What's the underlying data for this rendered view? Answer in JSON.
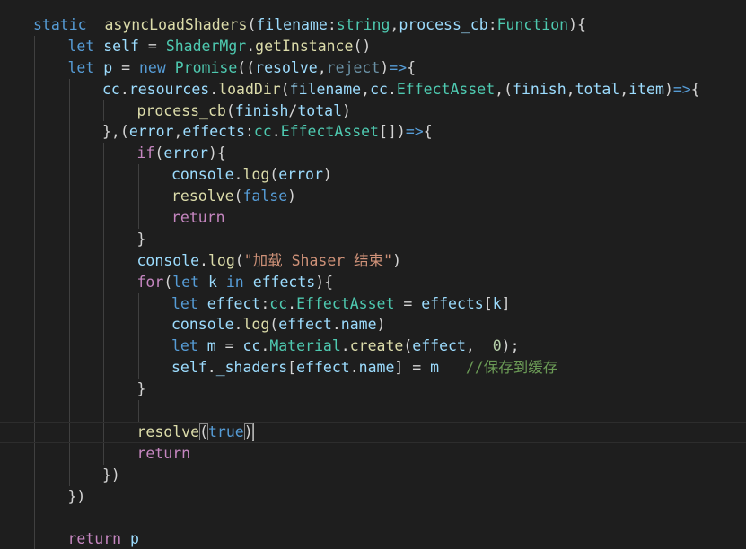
{
  "editor": {
    "colors": {
      "background": "#1e1e1e",
      "keyword": "#569cd6",
      "control": "#c586c0",
      "function": "#dcdcaa",
      "variable": "#9cdcfe",
      "type": "#4ec9b0",
      "string": "#ce9178",
      "number": "#b5cea8",
      "comment": "#6a9955"
    },
    "current_line": 19,
    "lines": [
      {
        "indent": 0,
        "tokens": [
          {
            "t": "static",
            "c": "kw"
          },
          {
            "t": "  "
          },
          {
            "t": "asyncLoadShaders",
            "c": "fn"
          },
          {
            "t": "("
          },
          {
            "t": "filename",
            "c": "var"
          },
          {
            "t": ":"
          },
          {
            "t": "string",
            "c": "type"
          },
          {
            "t": ","
          },
          {
            "t": "process_cb",
            "c": "var"
          },
          {
            "t": ":"
          },
          {
            "t": "Function",
            "c": "type"
          },
          {
            "t": "){"
          }
        ]
      },
      {
        "indent": 1,
        "tokens": [
          {
            "t": "let",
            "c": "kw"
          },
          {
            "t": " "
          },
          {
            "t": "self",
            "c": "var"
          },
          {
            "t": " = "
          },
          {
            "t": "ShaderMgr",
            "c": "type"
          },
          {
            "t": "."
          },
          {
            "t": "getInstance",
            "c": "fn"
          },
          {
            "t": "()"
          }
        ]
      },
      {
        "indent": 1,
        "tokens": [
          {
            "t": "let",
            "c": "kw"
          },
          {
            "t": " "
          },
          {
            "t": "p",
            "c": "var"
          },
          {
            "t": " = "
          },
          {
            "t": "new",
            "c": "kw"
          },
          {
            "t": " "
          },
          {
            "t": "Promise",
            "c": "type"
          },
          {
            "t": "(("
          },
          {
            "t": "resolve",
            "c": "var"
          },
          {
            "t": ","
          },
          {
            "t": "reject",
            "c": "unused"
          },
          {
            "t": ")"
          },
          {
            "t": "=>",
            "c": "kw"
          },
          {
            "t": "{"
          }
        ]
      },
      {
        "indent": 2,
        "tokens": [
          {
            "t": "cc",
            "c": "var"
          },
          {
            "t": "."
          },
          {
            "t": "resources",
            "c": "var"
          },
          {
            "t": "."
          },
          {
            "t": "loadDir",
            "c": "fn"
          },
          {
            "t": "("
          },
          {
            "t": "filename",
            "c": "var"
          },
          {
            "t": ","
          },
          {
            "t": "cc",
            "c": "var"
          },
          {
            "t": "."
          },
          {
            "t": "EffectAsset",
            "c": "type"
          },
          {
            "t": ",("
          },
          {
            "t": "finish",
            "c": "var"
          },
          {
            "t": ","
          },
          {
            "t": "total",
            "c": "var"
          },
          {
            "t": ","
          },
          {
            "t": "item",
            "c": "var"
          },
          {
            "t": ")"
          },
          {
            "t": "=>",
            "c": "kw"
          },
          {
            "t": "{"
          }
        ]
      },
      {
        "indent": 3,
        "tokens": [
          {
            "t": "process_cb",
            "c": "fn"
          },
          {
            "t": "("
          },
          {
            "t": "finish",
            "c": "var"
          },
          {
            "t": "/"
          },
          {
            "t": "total",
            "c": "var"
          },
          {
            "t": ")"
          }
        ]
      },
      {
        "indent": 2,
        "tokens": [
          {
            "t": "},("
          },
          {
            "t": "error",
            "c": "var"
          },
          {
            "t": ","
          },
          {
            "t": "effects",
            "c": "var"
          },
          {
            "t": ":"
          },
          {
            "t": "cc",
            "c": "type"
          },
          {
            "t": "."
          },
          {
            "t": "EffectAsset",
            "c": "type"
          },
          {
            "t": "[])"
          },
          {
            "t": "=>",
            "c": "kw"
          },
          {
            "t": "{"
          }
        ]
      },
      {
        "indent": 3,
        "tokens": [
          {
            "t": "if",
            "c": "ctrl"
          },
          {
            "t": "("
          },
          {
            "t": "error",
            "c": "var"
          },
          {
            "t": "){"
          }
        ]
      },
      {
        "indent": 4,
        "tokens": [
          {
            "t": "console",
            "c": "var"
          },
          {
            "t": "."
          },
          {
            "t": "log",
            "c": "fn"
          },
          {
            "t": "("
          },
          {
            "t": "error",
            "c": "var"
          },
          {
            "t": ")"
          }
        ]
      },
      {
        "indent": 4,
        "tokens": [
          {
            "t": "resolve",
            "c": "fn"
          },
          {
            "t": "("
          },
          {
            "t": "false",
            "c": "kw"
          },
          {
            "t": ")"
          }
        ]
      },
      {
        "indent": 4,
        "tokens": [
          {
            "t": "return",
            "c": "ctrl"
          }
        ]
      },
      {
        "indent": 3,
        "tokens": [
          {
            "t": "}"
          }
        ]
      },
      {
        "indent": 3,
        "tokens": [
          {
            "t": "console",
            "c": "var"
          },
          {
            "t": "."
          },
          {
            "t": "log",
            "c": "fn"
          },
          {
            "t": "("
          },
          {
            "t": "\"加载 Shaser 结束\"",
            "c": "str"
          },
          {
            "t": ")"
          }
        ]
      },
      {
        "indent": 3,
        "tokens": [
          {
            "t": "for",
            "c": "ctrl"
          },
          {
            "t": "("
          },
          {
            "t": "let",
            "c": "kw"
          },
          {
            "t": " "
          },
          {
            "t": "k",
            "c": "var"
          },
          {
            "t": " "
          },
          {
            "t": "in",
            "c": "kw"
          },
          {
            "t": " "
          },
          {
            "t": "effects",
            "c": "var"
          },
          {
            "t": "){"
          }
        ]
      },
      {
        "indent": 4,
        "tokens": [
          {
            "t": "let",
            "c": "kw"
          },
          {
            "t": " "
          },
          {
            "t": "effect",
            "c": "var"
          },
          {
            "t": ":"
          },
          {
            "t": "cc",
            "c": "type"
          },
          {
            "t": "."
          },
          {
            "t": "EffectAsset",
            "c": "type"
          },
          {
            "t": " = "
          },
          {
            "t": "effects",
            "c": "var"
          },
          {
            "t": "["
          },
          {
            "t": "k",
            "c": "var"
          },
          {
            "t": "]"
          }
        ]
      },
      {
        "indent": 4,
        "tokens": [
          {
            "t": "console",
            "c": "var"
          },
          {
            "t": "."
          },
          {
            "t": "log",
            "c": "fn"
          },
          {
            "t": "("
          },
          {
            "t": "effect",
            "c": "var"
          },
          {
            "t": "."
          },
          {
            "t": "name",
            "c": "var"
          },
          {
            "t": ")"
          }
        ]
      },
      {
        "indent": 4,
        "tokens": [
          {
            "t": "let",
            "c": "kw"
          },
          {
            "t": " "
          },
          {
            "t": "m",
            "c": "var"
          },
          {
            "t": " = "
          },
          {
            "t": "cc",
            "c": "var"
          },
          {
            "t": "."
          },
          {
            "t": "Material",
            "c": "type"
          },
          {
            "t": "."
          },
          {
            "t": "create",
            "c": "fn"
          },
          {
            "t": "("
          },
          {
            "t": "effect",
            "c": "var"
          },
          {
            "t": ",  "
          },
          {
            "t": "0",
            "c": "num"
          },
          {
            "t": ");"
          }
        ]
      },
      {
        "indent": 4,
        "tokens": [
          {
            "t": "self",
            "c": "var"
          },
          {
            "t": "."
          },
          {
            "t": "_shaders",
            "c": "var"
          },
          {
            "t": "["
          },
          {
            "t": "effect",
            "c": "var"
          },
          {
            "t": "."
          },
          {
            "t": "name",
            "c": "var"
          },
          {
            "t": "] = "
          },
          {
            "t": "m",
            "c": "var"
          },
          {
            "t": "   "
          },
          {
            "t": "//保存到缓存",
            "c": "cmt"
          }
        ]
      },
      {
        "indent": 3,
        "tokens": [
          {
            "t": "}"
          }
        ]
      },
      {
        "indent": 0,
        "tokens": [],
        "guides": 4
      },
      {
        "indent": 3,
        "tokens": [
          {
            "t": "resolve",
            "c": "fn"
          },
          {
            "t": "(",
            "m": 1
          },
          {
            "t": "true",
            "c": "kw"
          },
          {
            "t": ")",
            "m": 1,
            "cursor": 1
          }
        ]
      },
      {
        "indent": 3,
        "tokens": [
          {
            "t": "return",
            "c": "ctrl"
          }
        ]
      },
      {
        "indent": 2,
        "tokens": [
          {
            "t": "})"
          }
        ]
      },
      {
        "indent": 1,
        "tokens": [
          {
            "t": "})"
          }
        ]
      },
      {
        "indent": 0,
        "tokens": [],
        "guides": 1
      },
      {
        "indent": 1,
        "tokens": [
          {
            "t": "return",
            "c": "ctrl"
          },
          {
            "t": " "
          },
          {
            "t": "p",
            "c": "var"
          }
        ]
      }
    ]
  }
}
